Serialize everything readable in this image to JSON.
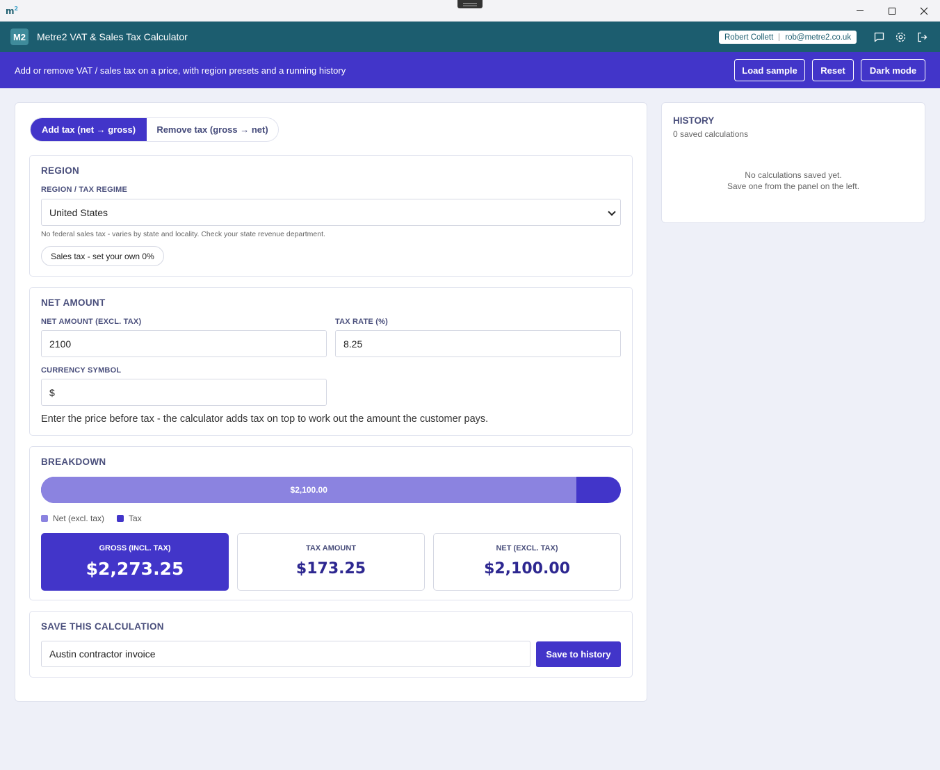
{
  "window": {
    "logo_text": "m",
    "logo_sup": "2"
  },
  "header": {
    "badge": "M2",
    "title": "Metre2 VAT & Sales Tax Calculator",
    "user_name": "Robert Collett",
    "user_email": "rob@metre2.co.uk",
    "icons": [
      "feedback-icon",
      "settings-icon",
      "logout-icon"
    ]
  },
  "banner": {
    "tagline": "Add or remove VAT / sales tax on a price, with region presets and a running history",
    "load_sample": "Load sample",
    "reset": "Reset",
    "dark_mode": "Dark mode"
  },
  "mode": {
    "add": "Add tax (net → gross)",
    "remove": "Remove tax (gross → net)",
    "selected": "add"
  },
  "region": {
    "heading": "REGION",
    "label": "REGION / TAX REGIME",
    "selected": "United States",
    "note": "No federal sales tax - varies by state and locality. Check your state revenue department.",
    "preset": "Sales tax - set your own 0%"
  },
  "amount": {
    "heading": "NET AMOUNT",
    "net_label": "NET AMOUNT (EXCL. TAX)",
    "net_value": "2100",
    "rate_label": "TAX RATE (%)",
    "rate_value": "8.25",
    "currency_label": "CURRENCY SYMBOL",
    "currency_value": "$",
    "help": "Enter the price before tax - the calculator adds tax on top to work out the amount the customer pays."
  },
  "breakdown": {
    "heading": "BREAKDOWN",
    "bar_label": "$2,100.00",
    "net_fraction": 0.9238,
    "legend_net": "Net (excl. tax)",
    "legend_tax": "Tax",
    "gross_label": "GROSS (INCL. TAX)",
    "gross_value": "$2,273.25",
    "tax_label": "TAX AMOUNT",
    "tax_value": "$173.25",
    "net_label": "NET (EXCL. TAX)",
    "net_value": "$2,100.00",
    "colors": {
      "net": "#8b83e0",
      "tax": "#4235c9"
    }
  },
  "save": {
    "heading": "SAVE THIS CALCULATION",
    "name_value": "Austin contractor invoice",
    "button": "Save to history"
  },
  "history": {
    "heading": "HISTORY",
    "count": "0 saved calculations",
    "empty_line1": "No calculations saved yet.",
    "empty_line2": "Save one from the panel on the left."
  }
}
